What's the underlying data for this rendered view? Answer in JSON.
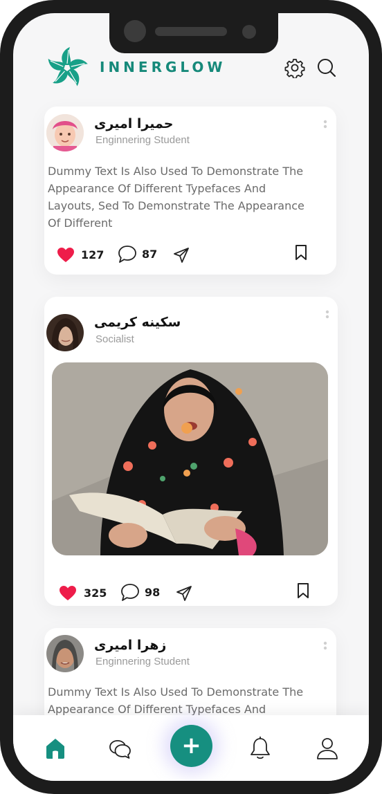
{
  "app": {
    "brand": "INNERGLOW"
  },
  "colors": {
    "accent": "#168f80",
    "like": "#ee1d4a",
    "text": "#1a1a1a",
    "muted": "#9a9a9a"
  },
  "header": {
    "icons": [
      "gear-icon",
      "search-icon"
    ]
  },
  "posts": [
    {
      "name": "حمیرا امیری",
      "role": "Enginnering Student",
      "text": [
        "Dummy Text Is Also Used To Demonstrate The",
        "Appearance Of Different Typefaces And",
        "Layouts, Sed To Demonstrate The Appearance",
        "Of Different"
      ],
      "likes": "127",
      "comments": "87"
    },
    {
      "name": "سکینه کریمی",
      "role": "Socialist",
      "image": "girl-reading-book-photo",
      "likes": "325",
      "comments": "98"
    },
    {
      "name": "زهرا امیری",
      "role": "Enginnering Student",
      "text": [
        "Dummy Text Is Also Used To Demonstrate The",
        "Appearance Of Different Typefaces And"
      ]
    }
  ],
  "bottom_nav": {
    "items": [
      "home-icon",
      "chat-icon",
      "add-icon",
      "bell-icon",
      "profile-icon"
    ],
    "fab_label": "+"
  }
}
